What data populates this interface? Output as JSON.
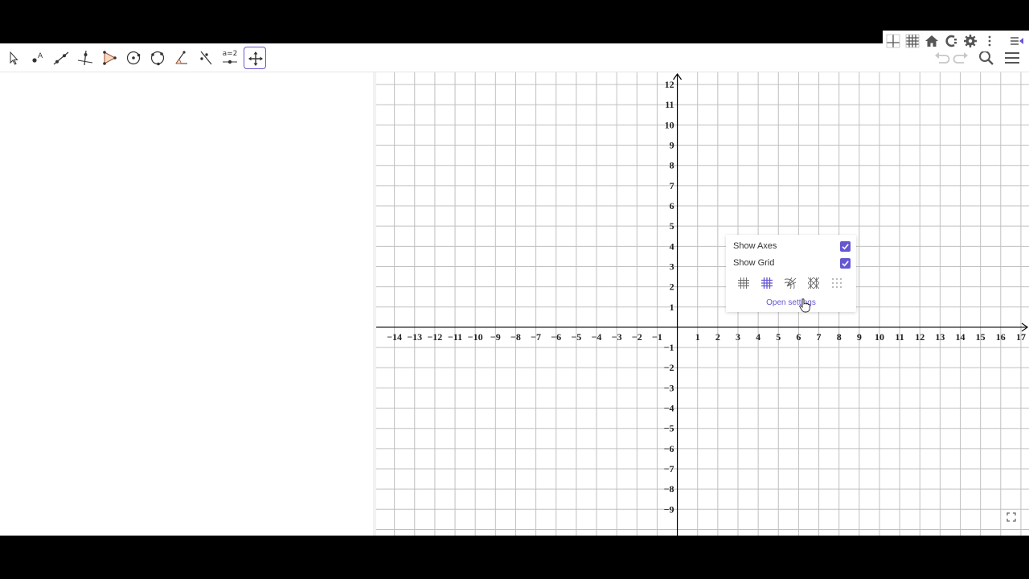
{
  "toolbar": {
    "tools": [
      {
        "name": "move-tool",
        "icon": "arrow-pointer-icon"
      },
      {
        "name": "point-tool",
        "icon": "point-icon",
        "label": "A"
      },
      {
        "name": "line-tool",
        "icon": "line-icon"
      },
      {
        "name": "perpendicular-line-tool",
        "icon": "perpendicular-icon"
      },
      {
        "name": "polygon-tool",
        "icon": "polygon-icon"
      },
      {
        "name": "circle-center-point-tool",
        "icon": "circle-icon"
      },
      {
        "name": "circle-three-points-tool",
        "icon": "circle-three-points-icon"
      },
      {
        "name": "angle-tool",
        "icon": "angle-icon"
      },
      {
        "name": "reflect-tool",
        "icon": "reflect-icon"
      },
      {
        "name": "slider-tool",
        "icon": "slider-icon",
        "label": "a=2"
      },
      {
        "name": "move-graphics-view-tool",
        "icon": "move-view-icon",
        "selected": true
      }
    ],
    "right": [
      "undo-icon",
      "redo-icon",
      "search-icon",
      "menu-icon"
    ]
  },
  "stylebar": [
    "axes-toggle-icon",
    "grid-toggle-icon",
    "home-icon",
    "point-capturing-icon",
    "gear-icon",
    "more-vertical-icon",
    "stylebar-toggle-icon"
  ],
  "popup": {
    "show_axes_label": "Show Axes",
    "show_axes_checked": true,
    "show_grid_label": "Show Grid",
    "show_grid_checked": true,
    "grid_options": [
      "major-minor-grid-icon",
      "major-grid-icon",
      "polar-grid-icon",
      "isometric-grid-icon",
      "dots-grid-icon"
    ],
    "selected_grid": "major-grid-icon",
    "open_settings_label": "Open settings"
  },
  "graph": {
    "x_labels": [
      "−14",
      "−13",
      "−12",
      "−11",
      "−10",
      "−9",
      "−8",
      "−7",
      "−6",
      "−5",
      "−4",
      "−3",
      "−2",
      "−1",
      "1",
      "2",
      "3",
      "4",
      "5",
      "6",
      "7",
      "8",
      "9",
      "10",
      "11",
      "12",
      "13",
      "14",
      "15",
      "16",
      "17"
    ],
    "y_labels": [
      "12",
      "11",
      "10",
      "9",
      "8",
      "7",
      "6",
      "5",
      "4",
      "3",
      "2",
      "1",
      "−1",
      "−2",
      "−3",
      "−4",
      "−5",
      "−6",
      "−7",
      "−8",
      "−9"
    ],
    "x_range": [
      -14.9,
      17.4
    ],
    "y_range": [
      -10.3,
      12.6
    ]
  },
  "colors": {
    "accent": "#6557d2",
    "grid": "#c0c0c0",
    "axes": "#000000"
  }
}
